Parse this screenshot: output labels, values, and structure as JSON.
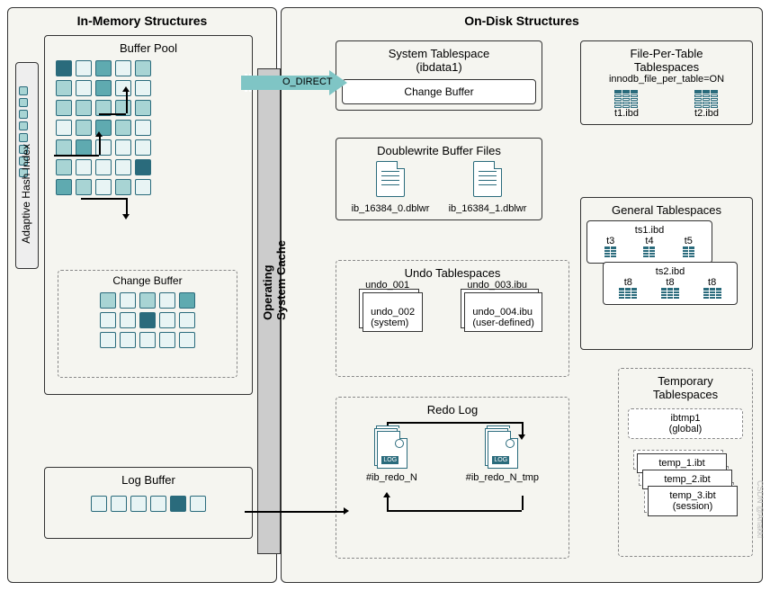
{
  "titles": {
    "in_memory": "In-Memory Structures",
    "on_disk": "On-Disk Structures"
  },
  "adaptive_hash_index": {
    "label": "Adaptive Hash Index"
  },
  "buffer_pool": {
    "title": "Buffer Pool"
  },
  "change_buffer": {
    "title": "Change Buffer"
  },
  "os_cache": {
    "label": "Operating\nSystem Cache"
  },
  "o_direct": {
    "label": "O_DIRECT"
  },
  "log_buffer": {
    "title": "Log Buffer"
  },
  "system_tablespace": {
    "title": "System Tablespace",
    "subtitle": "(ibdata1)",
    "change_buffer": "Change Buffer"
  },
  "file_per_table": {
    "title": "File-Per-Table\nTablespaces",
    "subtitle": "innodb_file_per_table=ON",
    "files": [
      "t1.ibd",
      "t2.ibd"
    ]
  },
  "doublewrite": {
    "title": "Doublewrite Buffer Files",
    "files": [
      "ib_16384_0.dblwr",
      "ib_16384_1.dblwr"
    ]
  },
  "general_tablespaces": {
    "title": "General Tablespaces",
    "ts1": {
      "label": "ts1.ibd",
      "tables": [
        "t3",
        "t4",
        "t5"
      ]
    },
    "ts2": {
      "label": "ts2.ibd",
      "tables": [
        "t8",
        "t8",
        "t8"
      ]
    }
  },
  "undo_tablespaces": {
    "title": "Undo Tablespaces",
    "system": {
      "files": [
        "undo_001",
        "undo_002"
      ],
      "note": "(system)"
    },
    "user": {
      "files": [
        "undo_003.ibu",
        "undo_004.ibu"
      ],
      "note": "(user-defined)"
    }
  },
  "redo_log": {
    "title": "Redo Log",
    "files": [
      "#ib_redo_N",
      "#ib_redo_N_tmp"
    ]
  },
  "temporary_tablespaces": {
    "title": "Temporary\nTablespaces",
    "global": {
      "file": "ibtmp1",
      "note": "(global)"
    },
    "session": {
      "files": [
        "temp_1.ibt",
        "temp_2.ibt",
        "temp_3.ibt"
      ],
      "note": "(session)"
    }
  },
  "watermark": "CSDN @Anakki"
}
